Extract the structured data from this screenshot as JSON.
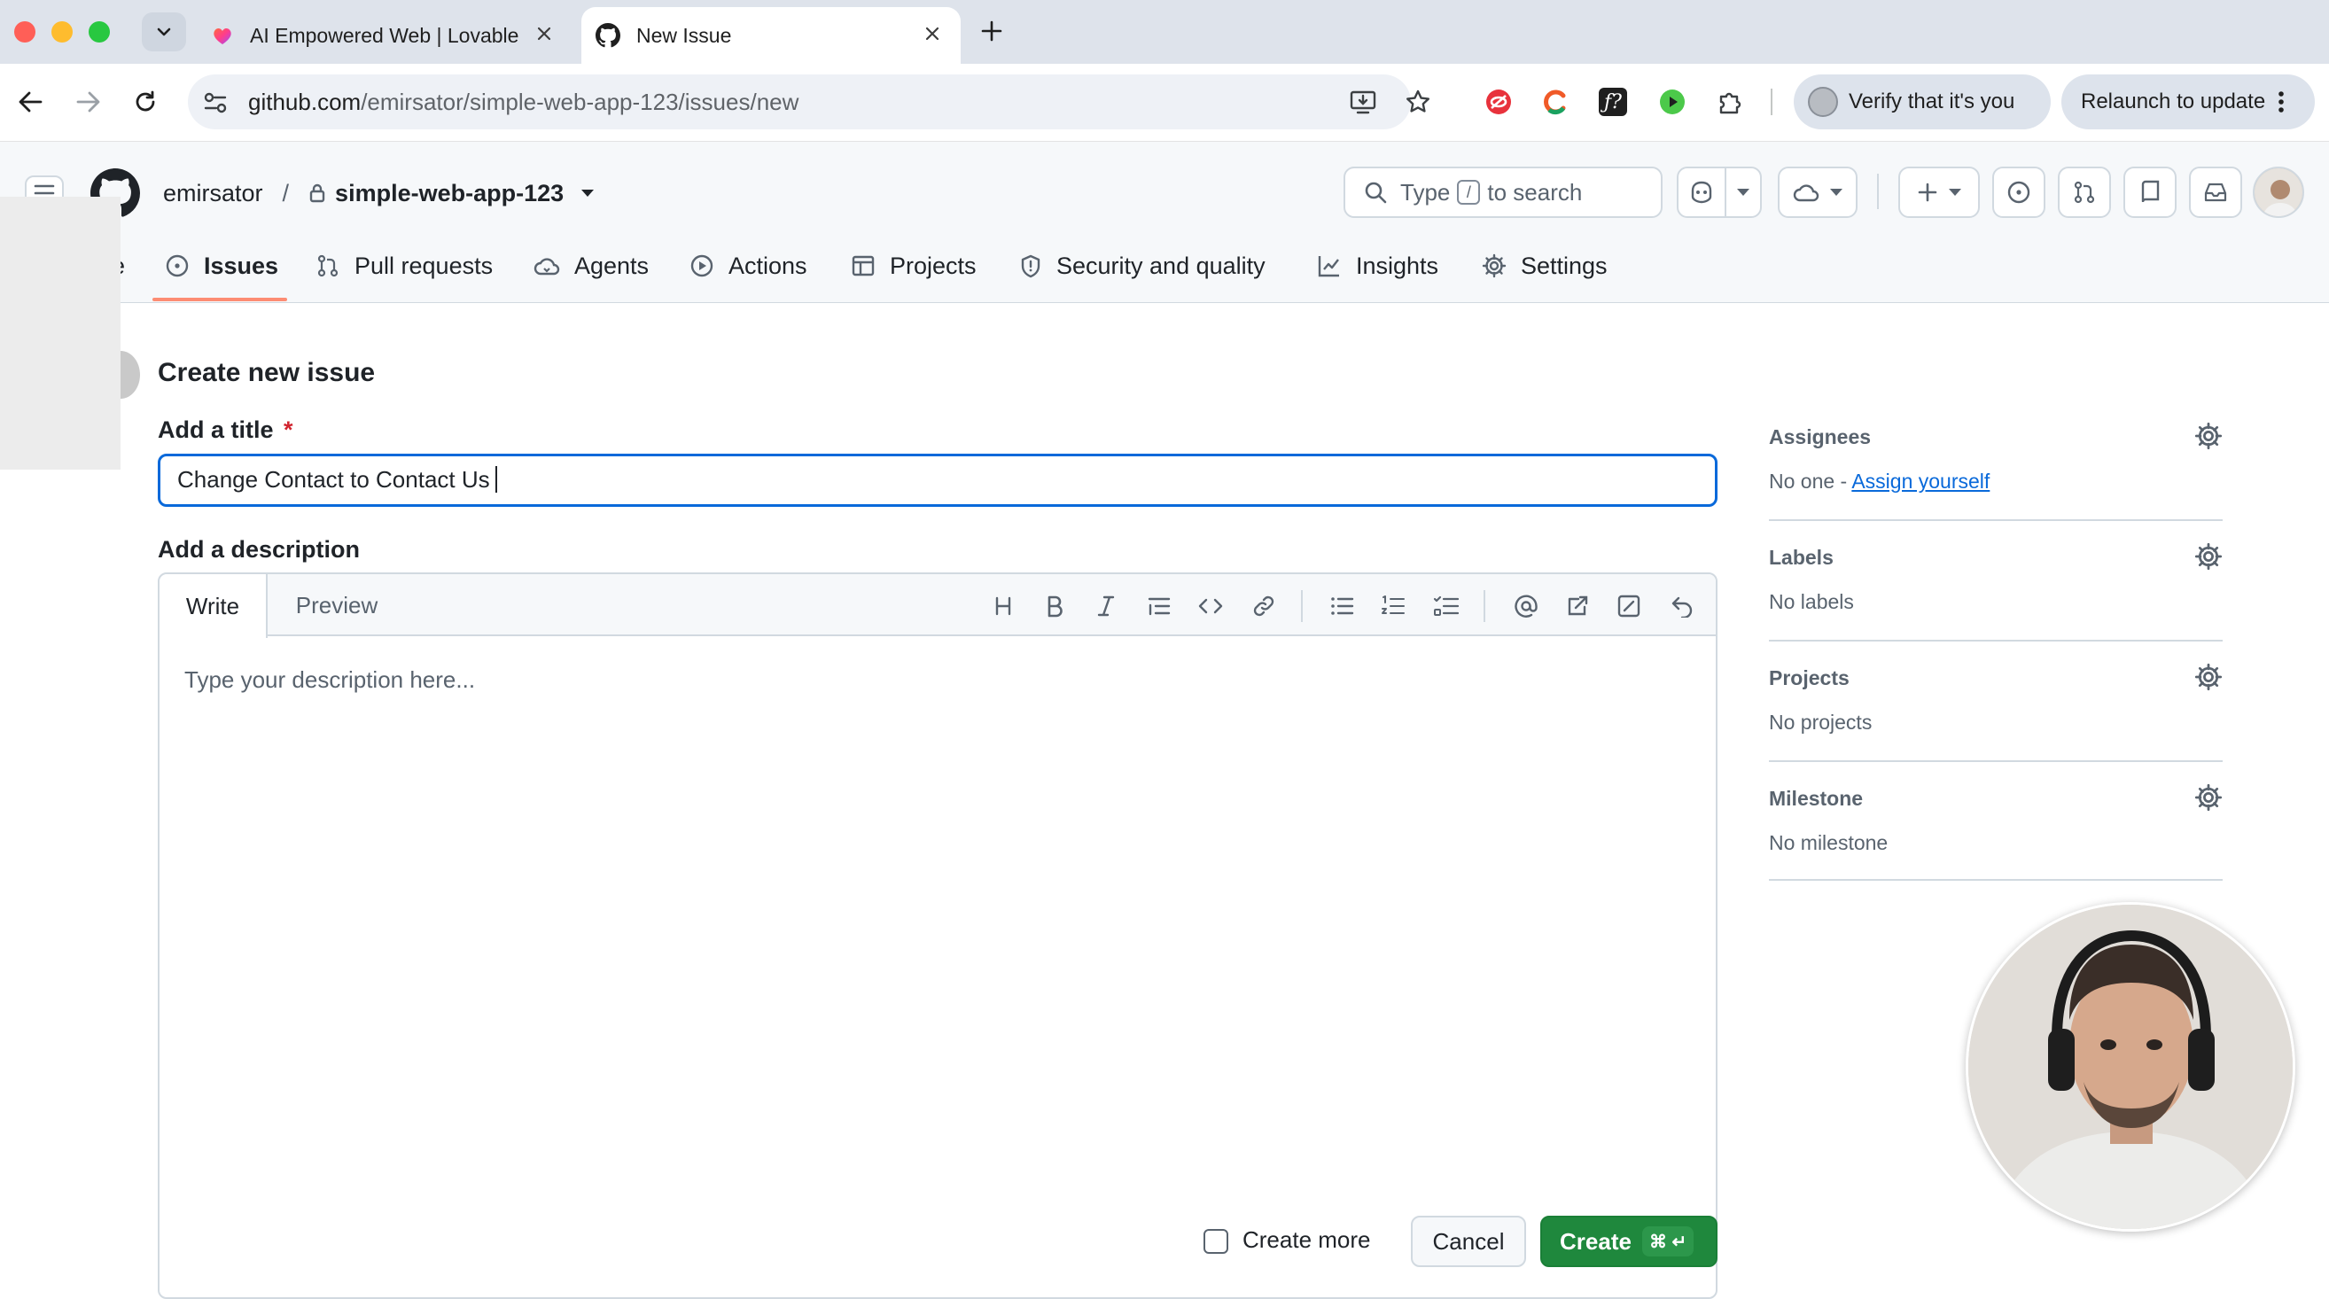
{
  "browser": {
    "tabs": [
      {
        "title": "AI Empowered Web | Lovable",
        "active": false
      },
      {
        "title": "New Issue",
        "active": true
      }
    ],
    "url_host": "github.com",
    "url_path": "/emirsator/simple-web-app-123/issues/new",
    "verify_label": "Verify that it's you",
    "relaunch_label": "Relaunch to update"
  },
  "repo": {
    "owner": "emirsator",
    "separator": "/",
    "name": "simple-web-app-123"
  },
  "search": {
    "prefix": "Type",
    "key": "/",
    "suffix": "to search"
  },
  "nav": {
    "partial": "e",
    "items": [
      {
        "label": "Issues",
        "icon": "issue-opened-icon",
        "selected": true
      },
      {
        "label": "Pull requests",
        "icon": "git-pull-request-icon"
      },
      {
        "label": "Agents",
        "icon": "agent-cloud-icon"
      },
      {
        "label": "Actions",
        "icon": "play-icon"
      },
      {
        "label": "Projects",
        "icon": "table-icon"
      },
      {
        "label": "Security and quality",
        "icon": "shield-icon"
      },
      {
        "label": "Insights",
        "icon": "graph-icon"
      },
      {
        "label": "Settings",
        "icon": "gear-icon"
      }
    ]
  },
  "form": {
    "heading": "Create new issue",
    "title_label": "Add a title",
    "required_mark": "*",
    "title_value": "Change Contact to Contact Us",
    "description_label": "Add a description",
    "tab_write": "Write",
    "tab_preview": "Preview",
    "description_placeholder": "Type your description here...",
    "create_more_label": "Create more",
    "create_more_checked": false,
    "cancel_label": "Cancel",
    "create_label": "Create",
    "create_shortcut": "⌘ ↵"
  },
  "sidebar": {
    "assignees": {
      "title": "Assignees",
      "empty": "No one -",
      "link": "Assign yourself"
    },
    "labels": {
      "title": "Labels",
      "value": "No labels"
    },
    "projects": {
      "title": "Projects",
      "value": "No projects"
    },
    "milestone": {
      "title": "Milestone",
      "value": "No milestone"
    }
  },
  "colors": {
    "accent": "#0969da",
    "create_green": "#1f883d",
    "selected_underline": "#fd8c73"
  }
}
